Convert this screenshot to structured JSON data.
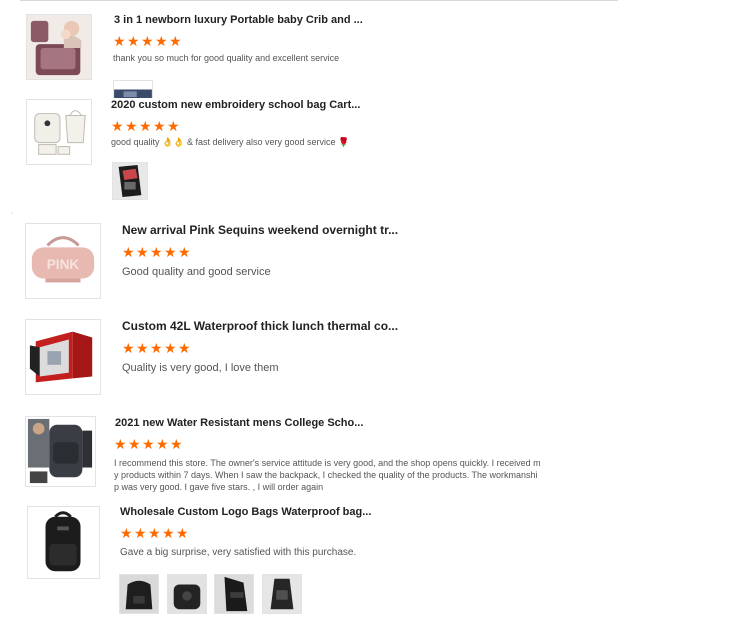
{
  "reviews": [
    {
      "title": "3 in 1 newborn luxury Portable baby Crib and ...",
      "rating": 5,
      "text": "thank you so much for good quality and excellent service",
      "thumb_icon": "baby-crib-bag-icon"
    },
    {
      "title": "2020 custom new embroidery school bag Cart...",
      "rating": 5,
      "text": "good quality 👌👌 & fast delivery also very good service 🌹",
      "thumb_icon": "school-bag-set-icon"
    },
    {
      "title": "New arrival Pink Sequins weekend overnight tr...",
      "rating": 5,
      "text": "Good quality and good service",
      "thumb_icon": "pink-duffel-bag-icon"
    },
    {
      "title": "Custom 42L Waterproof thick lunch thermal co...",
      "rating": 5,
      "text": "Quality is very good, I love them",
      "thumb_icon": "thermal-cooler-bag-icon"
    },
    {
      "title": "2021 new Water Resistant mens College Scho...",
      "rating": 5,
      "text_lines": [
        "I recommend this store. The owner's service attitude is very good, and the shop opens quickly. I received m",
        "y products within 7 days. When I saw the backpack, I checked the quality of the products. The workmanshi",
        "p was very good. I gave five stars. , I will order again"
      ],
      "thumb_icon": "college-backpack-icon"
    },
    {
      "title": "Wholesale Custom Logo Bags Waterproof bag...",
      "rating": 5,
      "text": "Gave a big surprise, very satisfied with this purchase.",
      "thumb_icon": "black-backpack-icon"
    }
  ],
  "colors": {
    "star": "#ff6a00",
    "text": "#555555",
    "title": "#222222"
  }
}
